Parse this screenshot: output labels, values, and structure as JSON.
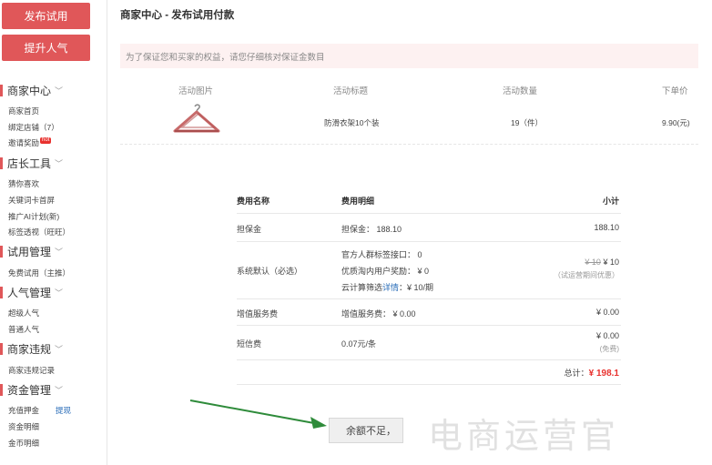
{
  "sidebar": {
    "publish_trial": "发布试用",
    "boost_popularity": "提升人气",
    "sections": [
      {
        "title": "商家中心",
        "items": [
          "商家首页",
          "绑定店铺（7）",
          "邀请奖励"
        ]
      },
      {
        "title": "店长工具",
        "items": [
          "猜你喜欢",
          "关键词卡首屏",
          "推广AI计划(新)",
          "标签透视（旺旺）"
        ]
      },
      {
        "title": "试用管理",
        "items": [
          "免费试用（主推）"
        ]
      },
      {
        "title": "人气管理",
        "items": [
          "超级人气",
          "普通人气"
        ]
      },
      {
        "title": "商家违规",
        "items": [
          "商家违规记录"
        ]
      },
      {
        "title": "资金管理",
        "items": [
          "充值押金",
          "资金明细",
          "金币明细"
        ]
      }
    ],
    "hot_badge": "hot",
    "withdraw_link": "提现"
  },
  "page": {
    "title": "商家中心 - 发布试用付款",
    "notice": "为了保证您和买家的权益，请您仔细核对保证金数目"
  },
  "activity": {
    "headers": [
      "活动图片",
      "活动标题",
      "活动数量",
      "下单价"
    ],
    "row": {
      "image": "hanger-image",
      "title": "防滑衣架10个装",
      "quantity": "19（件）",
      "price": "9.90(元)"
    }
  },
  "fees": {
    "headers": {
      "name": "费用名称",
      "detail": "费用明细",
      "subtotal": "小计"
    },
    "deposit": {
      "name": "担保金",
      "detail": "担保金： 188.10",
      "subtotal": "188.10"
    },
    "system": {
      "name": "系统默认（必选）",
      "lines": [
        "官方人群标签接口： 0",
        "优质淘内用户奖励： ¥ 0",
        "云计算筛选",
        "详情",
        "：¥ 10/期"
      ],
      "old_price": "¥ 10",
      "new_price": "¥ 10",
      "note": "（试运营期间优惠）"
    },
    "value_added": {
      "name": "增值服务费",
      "detail": "增值服务费： ¥ 0.00",
      "subtotal": "¥ 0.00"
    },
    "sms": {
      "name": "短信费",
      "detail": "0.07元/条",
      "subtotal": "¥ 0.00",
      "note": "(免费)"
    },
    "total_label": "总计：",
    "total_amount": "¥ 198.1"
  },
  "footer": {
    "button": "余额不足，",
    "watermark": "电商运营官"
  },
  "colors": {
    "accent": "#e05759",
    "link": "#2a6db8",
    "total": "#e8312e",
    "arrow": "#2e8b3a"
  }
}
